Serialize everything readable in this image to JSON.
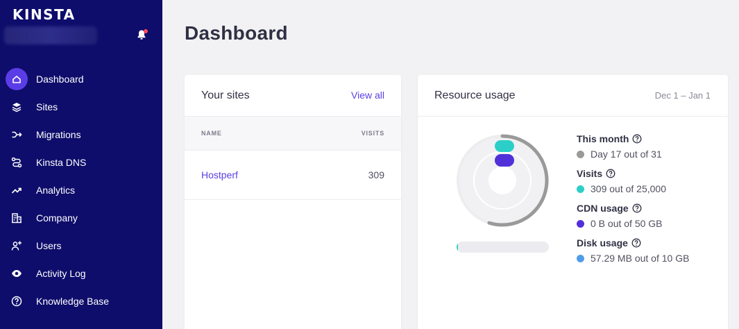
{
  "brand": {
    "logo_text": "KINSTA"
  },
  "sidebar": {
    "items": [
      {
        "label": "Dashboard",
        "icon": "home-icon",
        "active": true
      },
      {
        "label": "Sites",
        "icon": "layers-icon"
      },
      {
        "label": "Migrations",
        "icon": "migrations-icon"
      },
      {
        "label": "Kinsta DNS",
        "icon": "dns-icon"
      },
      {
        "label": "Analytics",
        "icon": "trend-icon"
      },
      {
        "label": "Company",
        "icon": "building-icon"
      },
      {
        "label": "Users",
        "icon": "user-add-icon"
      },
      {
        "label": "Activity Log",
        "icon": "eye-icon"
      },
      {
        "label": "Knowledge Base",
        "icon": "help-circle-icon"
      }
    ]
  },
  "page": {
    "title": "Dashboard"
  },
  "sites_card": {
    "title": "Your sites",
    "view_all": "View all",
    "columns": {
      "name": "NAME",
      "visits": "VISITS"
    },
    "rows": [
      {
        "name": "Hostperf",
        "visits": "309"
      }
    ]
  },
  "resource_card": {
    "title": "Resource usage",
    "date_range": "Dec 1 – Jan 1",
    "stats": [
      {
        "title": "This month",
        "value": "Day 17 out of 31",
        "color": "#9a9a9a"
      },
      {
        "title": "Visits",
        "value": "309 out of 25,000",
        "color": "#2ccfc7"
      },
      {
        "title": "CDN usage",
        "value": "0 B out of 50 GB",
        "color": "#5230d9"
      },
      {
        "title": "Disk usage",
        "value": "57.29 MB out of 10 GB",
        "color": "#4f9de8"
      }
    ],
    "month_progress": 0.548,
    "bar_progress": 0.012
  },
  "colors": {
    "sidebar_bg": "#0e0d6b",
    "accent": "#5b3de8",
    "teal": "#2ccfc7",
    "purple": "#5230d9",
    "blue": "#4f9de8",
    "gray": "#9a9a9a"
  }
}
